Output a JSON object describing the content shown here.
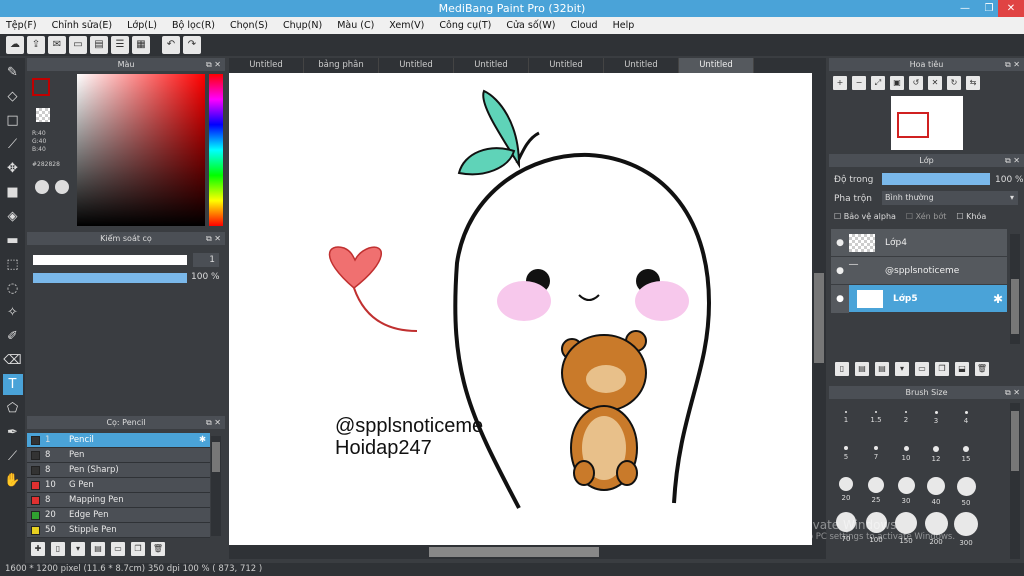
{
  "window": {
    "title": "MediBang Paint Pro (32bit)"
  },
  "menu": [
    "Tệp(F)",
    "Chỉnh sửa(E)",
    "Lớp(L)",
    "Bộ lọc(R)",
    "Chọn(S)",
    "Chụp(N)",
    "Màu (C)",
    "Xem(V)",
    "Công cụ(T)",
    "Cửa số(W)",
    "Cloud",
    "Help"
  ],
  "color_panel": {
    "title": "Màu",
    "r": "R:40",
    "g": "G:40",
    "b": "B:40",
    "hex": "#282828",
    "accent": "#c00000"
  },
  "brush_control": {
    "title": "Kiểm soát cọ",
    "size_value": "1",
    "opacity_value": "100 %"
  },
  "brush_panel": {
    "title": "Cọ: Pencil",
    "items": [
      {
        "size": "1",
        "name": "Pencil",
        "color": "#333333"
      },
      {
        "size": "8",
        "name": "Pen",
        "color": "#333333"
      },
      {
        "size": "8",
        "name": "Pen (Sharp)",
        "color": "#333333"
      },
      {
        "size": "10",
        "name": "G Pen",
        "color": "#e03030"
      },
      {
        "size": "8",
        "name": "Mapping Pen",
        "color": "#e03030"
      },
      {
        "size": "20",
        "name": "Edge Pen",
        "color": "#30a030"
      },
      {
        "size": "50",
        "name": "Stipple Pen",
        "color": "#e8d020"
      }
    ]
  },
  "tabs": [
    "Untitled",
    "bảng phân tích.jpg",
    "Untitled",
    "Untitled",
    "Untitled",
    "Untitled",
    "Untitled"
  ],
  "canvas": {
    "line1": "@spplsnoticeme",
    "line2": "Hoidap247"
  },
  "navigator": {
    "title": "Hoa tiêu"
  },
  "layers": {
    "title": "Lớp",
    "opacity_label": "Độ trong",
    "opacity_value": "100 %",
    "blend_label": "Pha trộn",
    "blend_value": "Bình thường",
    "protect_alpha": "Bảo vệ alpha",
    "clip": "Xén bớt",
    "lock": "Khóa",
    "items": [
      {
        "name": "Lớp4"
      },
      {
        "name": "@spplsnoticeme"
      },
      {
        "name": "Lớp5"
      }
    ]
  },
  "brush_size": {
    "title": "Brush Size",
    "sizes": [
      "1",
      "1.5",
      "2",
      "3",
      "4",
      "5",
      "7",
      "10",
      "12",
      "15",
      "20",
      "25",
      "30",
      "40",
      "50",
      "70",
      "100",
      "150",
      "200",
      "300"
    ]
  },
  "status": {
    "text": "1600 * 1200 pixel   (11.6 * 8.7cm)   350 dpi   100 %   ( 873, 712 )"
  },
  "watermark": {
    "line1": "Activate Windows",
    "line2": "Go to PC settings to activate Windows."
  }
}
